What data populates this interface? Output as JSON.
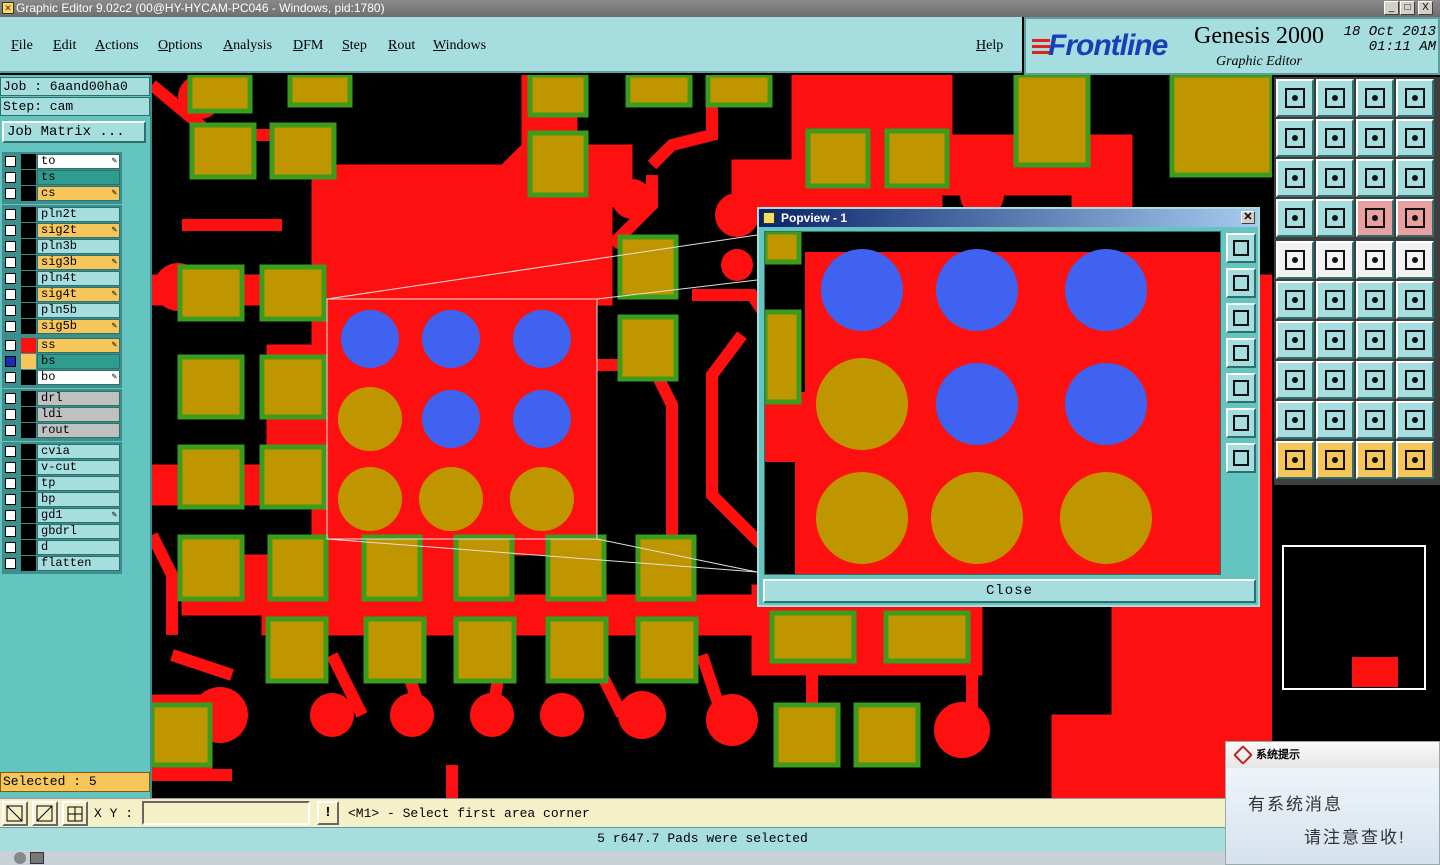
{
  "window": {
    "title": "Graphic Editor 9.02c2 (00@HY-HYCAM-PC046 - Windows, pid:1780)",
    "minimize": "_",
    "maximize": "□",
    "close": "X"
  },
  "menu": {
    "file": "File",
    "edit": "Edit",
    "actions": "Actions",
    "options": "Options",
    "analysis": "Analysis",
    "dfm": "DFM",
    "step": "Step",
    "rout": "Rout",
    "windows": "Windows",
    "help": "Help"
  },
  "logo": {
    "brand": "Frontline",
    "product": "Genesis 2000",
    "subtitle": "Graphic Editor",
    "date": "18 Oct 2013",
    "time": "01:11 AM"
  },
  "job": {
    "job_line": "Job : 6aand00ha0",
    "step_line": "Step: cam",
    "matrix_button": "Job Matrix ..."
  },
  "layers": [
    {
      "name": "to",
      "bg": "#ffffff",
      "pen": true
    },
    {
      "name": "ts",
      "bg": "#2e9c8e",
      "pen": false
    },
    {
      "name": "cs",
      "bg": "#f7c65a",
      "pen": true
    },
    {
      "name": "pln2t",
      "bg": "#a6dedf",
      "pen": false
    },
    {
      "name": "sig2t",
      "bg": "#f7c65a",
      "pen": true
    },
    {
      "name": "pln3b",
      "bg": "#a6dedf",
      "pen": false
    },
    {
      "name": "sig3b",
      "bg": "#f7c65a",
      "pen": true
    },
    {
      "name": "pln4t",
      "bg": "#a6dedf",
      "pen": false
    },
    {
      "name": "sig4t",
      "bg": "#f7c65a",
      "pen": true
    },
    {
      "name": "pln5b",
      "bg": "#a6dedf",
      "pen": false
    },
    {
      "name": "sig5b",
      "bg": "#f7c65a",
      "pen": true
    },
    {
      "name": "ss",
      "bg": "#f7c65a",
      "pen": true
    },
    {
      "name": "bs",
      "bg": "#2e9c8e",
      "pen": false
    },
    {
      "name": "bo",
      "bg": "#ffffff",
      "pen": true
    },
    {
      "name": "drl",
      "bg": "#c0c0c0",
      "pen": false
    },
    {
      "name": "ldi",
      "bg": "#c0c0c0",
      "pen": false
    },
    {
      "name": "rout",
      "bg": "#c0c0c0",
      "pen": false
    },
    {
      "name": "cvia",
      "bg": "#a6dedf",
      "pen": false
    },
    {
      "name": "v-cut",
      "bg": "#a6dedf",
      "pen": false
    },
    {
      "name": "tp",
      "bg": "#a6dedf",
      "pen": false
    },
    {
      "name": "bp",
      "bg": "#a6dedf",
      "pen": false
    },
    {
      "name": "gd1",
      "bg": "#a6dedf",
      "pen": true
    },
    {
      "name": "gbdrl",
      "bg": "#a6dedf",
      "pen": false
    },
    {
      "name": "d",
      "bg": "#a6dedf",
      "pen": false
    },
    {
      "name": "flatten",
      "bg": "#a6dedf",
      "pen": false
    }
  ],
  "selection": {
    "selected_text": "Selected : 5"
  },
  "popview": {
    "title": "Popview - 1",
    "close_label": "Close"
  },
  "command": {
    "xy_label": "X Y :",
    "xy_value": "",
    "excl": "!",
    "prompt": "<M1> - Select first area corner"
  },
  "status": {
    "message": "5 r647.7 Pads were selected"
  },
  "notification": {
    "title": "系统提示",
    "line1": "有系统消息",
    "line2": "请注意查收!"
  },
  "colors": {
    "copper": "#ff1010",
    "pad": "#c09600",
    "pad_edge": "#3c9c1c",
    "selected": "#3f62f0",
    "panel": "#63c4c0",
    "panel_light": "#a6dedf"
  }
}
